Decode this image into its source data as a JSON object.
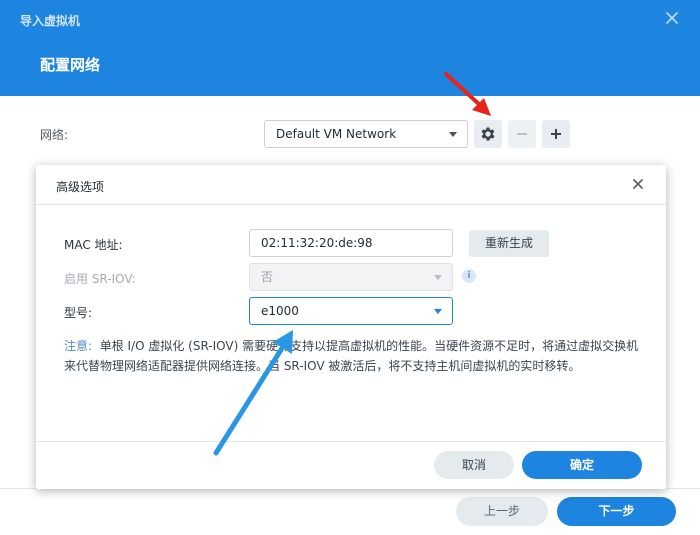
{
  "wizard": {
    "title": "导入虚拟机",
    "step_title": "配置网络",
    "network_label": "网络:",
    "network_value": "Default VM Network",
    "prev_label": "上一步",
    "next_label": "下一步"
  },
  "dialog": {
    "title": "高级选项",
    "mac_label": "MAC 地址:",
    "mac_value": "02:11:32:20:de:98",
    "regenerate_label": "重新生成",
    "sriov_label": "启用 SR-IOV:",
    "sriov_value": "否",
    "model_label": "型号:",
    "model_value": "e1000",
    "note_label": "注意:",
    "note_text": "单根 I/O 虚拟化 (SR-IOV) 需要硬件支持以提高虚拟机的性能。当硬件资源不足时，将通过虚拟交换机来代替物理网络适配器提供网络连接。当 SR-IOV 被激活后，将不支持主机间虚拟机的实时移转。",
    "cancel_label": "取消",
    "ok_label": "确定"
  },
  "icons": {
    "wizard_close": "close-icon",
    "settings": "gear-icon",
    "remove": "minus-icon",
    "add": "plus-icon",
    "dialog_close": "close-icon",
    "info": "info-icon",
    "annotation_red": "arrow-annotation",
    "annotation_blue": "arrow-annotation"
  },
  "colors": {
    "accent": "#1d84e0",
    "annotation_red": "#e8231b",
    "annotation_blue": "#2b95e6"
  }
}
